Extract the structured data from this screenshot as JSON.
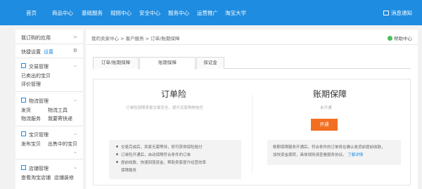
{
  "topnav": {
    "items": [
      "首页",
      "商品中心",
      "基础服务",
      "规则中心",
      "安全中心",
      "服务中心",
      "运营推广",
      "淘宝大学"
    ],
    "messages": "消息通知"
  },
  "sidebar": {
    "my_apps": "我订购的应用",
    "quick_settings": "快捷设置",
    "quick_settings_link": "设置",
    "sections": [
      {
        "title": "交易管理",
        "items": [
          "已卖出的宝贝",
          "评价管理"
        ]
      },
      {
        "title": "物流管理",
        "items": [
          "发货",
          "物流工具",
          "物流服务",
          "我要寄快递"
        ]
      },
      {
        "title": "宝贝管理",
        "items": [
          "发布宝贝",
          "出售中的宝贝"
        ]
      },
      {
        "title": "店铺管理",
        "items": [
          "查看淘宝店铺",
          "店铺装修"
        ]
      }
    ]
  },
  "main": {
    "breadcrumb": "我的卖家中心 > 客户服务 > 订单/账期保障",
    "help": "帮助中心",
    "tabs": [
      "订单/账期保障",
      "账期保障",
      "保证金"
    ],
    "order": {
      "title": "订单险",
      "subtitle": "订单险保障卖家交易安全，提升买家购物信任",
      "bullets": [
        "交易完成后，卖家无需等待，即可获得保险赔付",
        "订单险开通后，自动保障符合条件的订单",
        "提前收款，快速回笼资金，帮助卖家提升经营效率",
        "保障服务"
      ]
    },
    "period": {
      "title": "账期保障",
      "status": "未开通",
      "button": "开通",
      "desc": [
        "账期保障服务开通后，符合条件的订单将在确认收货前提前收款，",
        "加快资金周转，具体规则请查看服务协议。",
        "了解详情"
      ]
    }
  }
}
